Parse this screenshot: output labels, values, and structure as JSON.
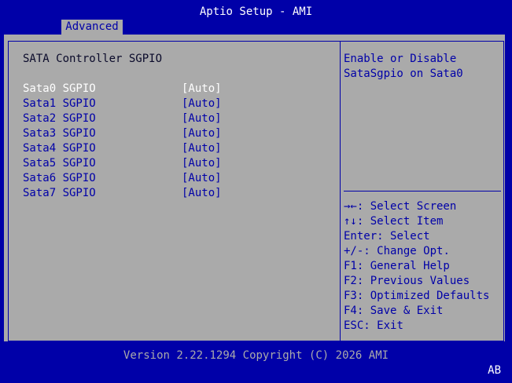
{
  "header": {
    "title": "Aptio Setup - AMI",
    "tabs": [
      {
        "label": "Advanced",
        "active": true
      }
    ]
  },
  "main": {
    "section_title": "SATA Controller SGPIO",
    "items": [
      {
        "label": "Sata0 SGPIO",
        "value": "[Auto]",
        "selected": true
      },
      {
        "label": "Sata1 SGPIO",
        "value": "[Auto]",
        "selected": false
      },
      {
        "label": "Sata2 SGPIO",
        "value": "[Auto]",
        "selected": false
      },
      {
        "label": "Sata3 SGPIO",
        "value": "[Auto]",
        "selected": false
      },
      {
        "label": "Sata4 SGPIO",
        "value": "[Auto]",
        "selected": false
      },
      {
        "label": "Sata5 SGPIO",
        "value": "[Auto]",
        "selected": false
      },
      {
        "label": "Sata6 SGPIO",
        "value": "[Auto]",
        "selected": false
      },
      {
        "label": "Sata7 SGPIO",
        "value": "[Auto]",
        "selected": false
      }
    ]
  },
  "help": {
    "text": "Enable or Disable\nSataSgpio on Sata0"
  },
  "keys": [
    {
      "key": "→←",
      "desc": ": Select Screen"
    },
    {
      "key": "↑↓",
      "desc": ": Select Item"
    },
    {
      "key": "Enter",
      "desc": ": Select"
    },
    {
      "key": "+/-",
      "desc": ": Change Opt."
    },
    {
      "key": "F1",
      "desc": ": General Help"
    },
    {
      "key": "F2",
      "desc": ": Previous Values"
    },
    {
      "key": "F3",
      "desc": ": Optimized Defaults"
    },
    {
      "key": "F4",
      "desc": ": Save & Exit"
    },
    {
      "key": "ESC",
      "desc": ": Exit"
    }
  ],
  "footer": {
    "version": "Version 2.22.1294 Copyright (C) 2026 AMI",
    "badge": "AB"
  },
  "colors": {
    "background": "#0000a8",
    "panel": "#aaaaaa",
    "text": "#0000a8",
    "selected_text": "#ffffff",
    "title_text": "#ffffff",
    "footer_text": "#aaaaaa"
  }
}
